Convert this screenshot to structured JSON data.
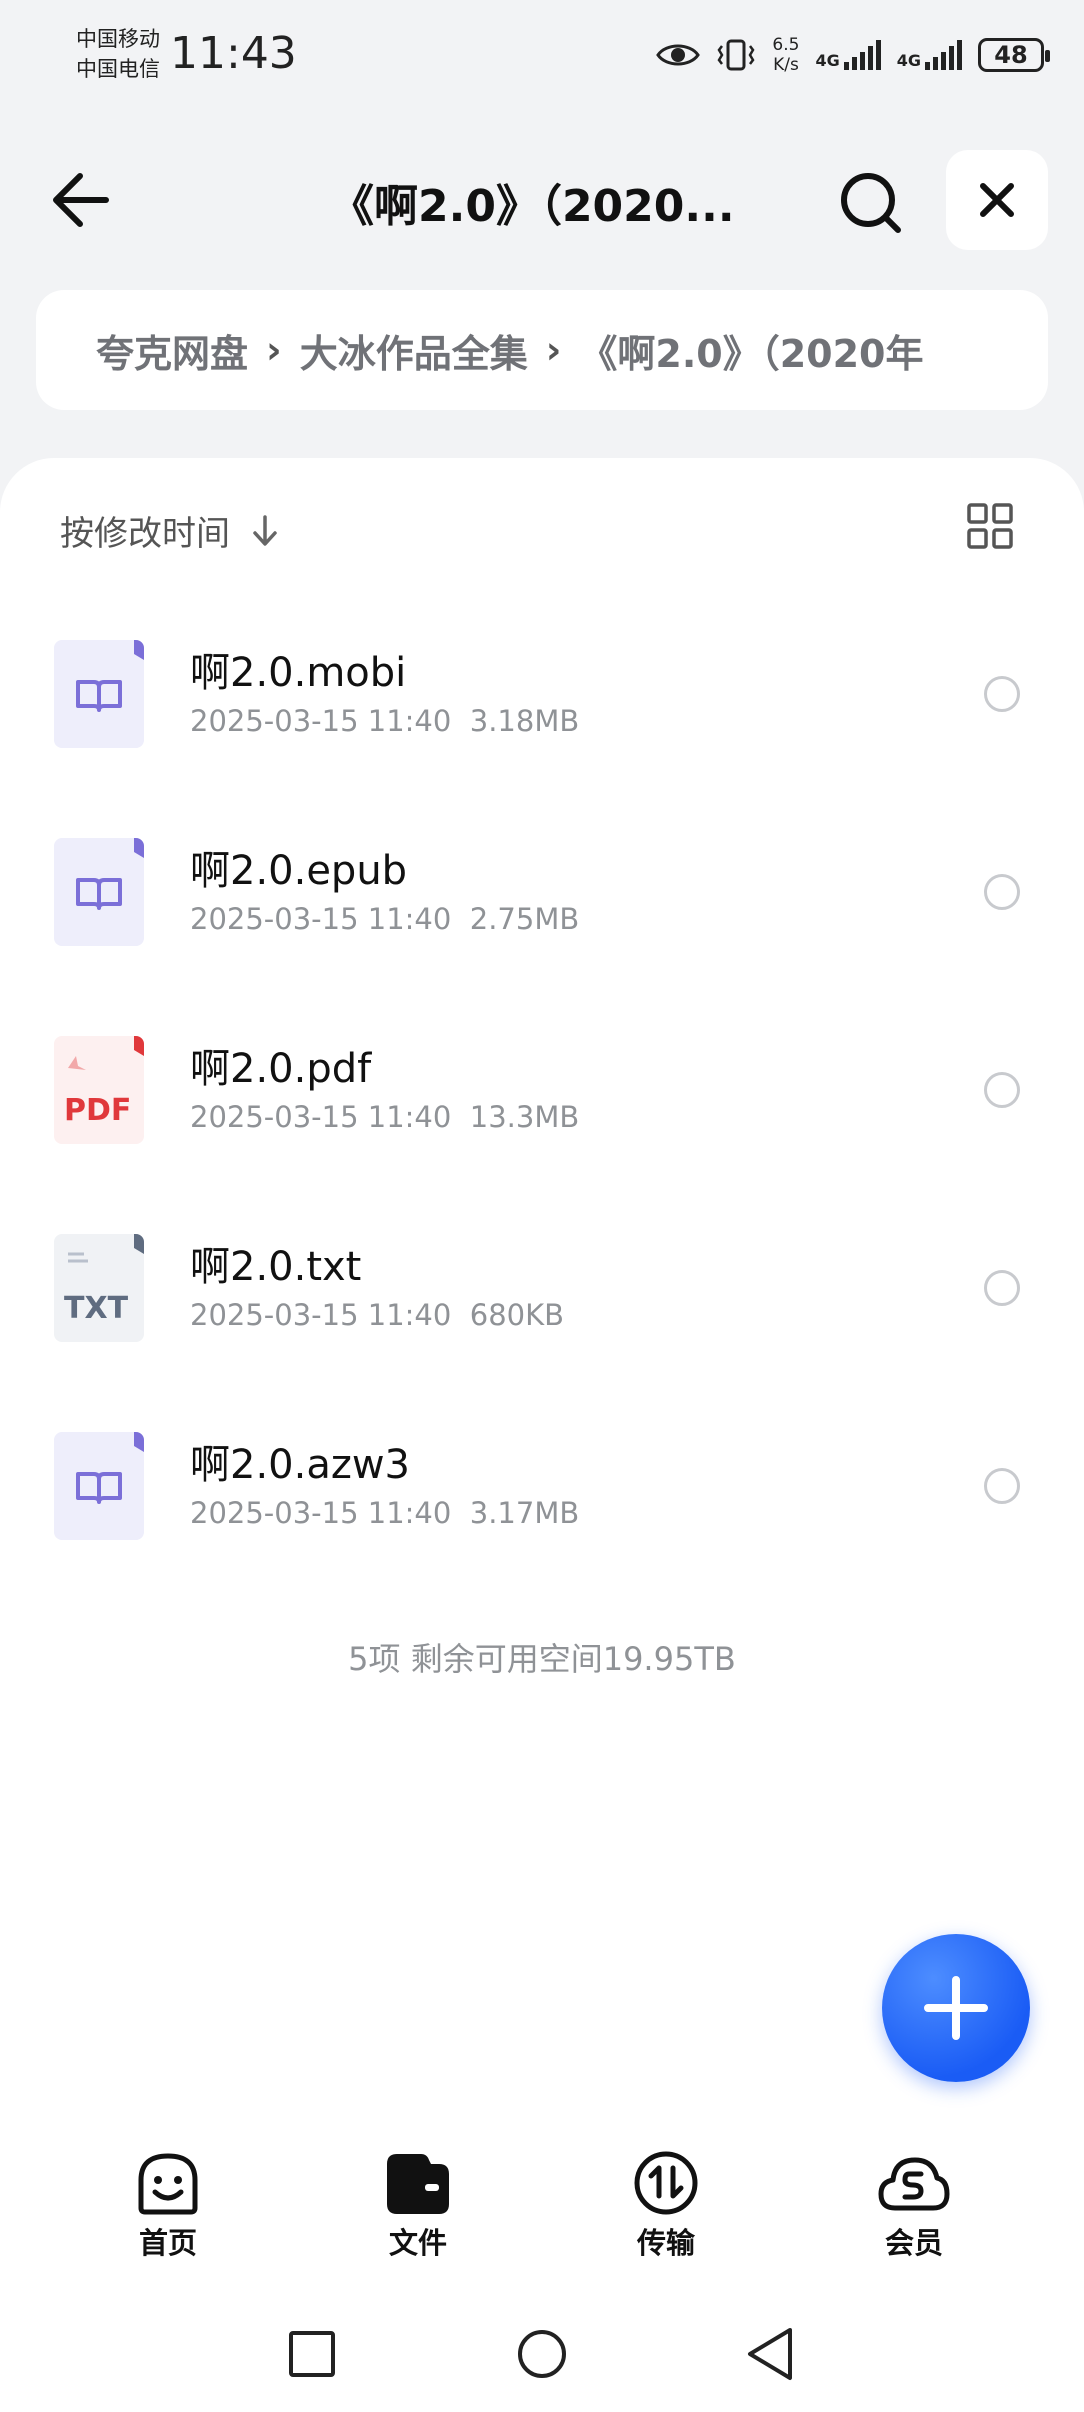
{
  "status_bar": {
    "carrier1": "中国移动",
    "carrier2": "中国电信",
    "time": "11:43",
    "speed_value": "6.5",
    "speed_unit": "K/s",
    "net1": "4G",
    "net2": "4G",
    "battery": "48"
  },
  "header": {
    "title": "《啊2.0》（2020..."
  },
  "breadcrumb": [
    "夸克网盘",
    "大冰作品全集",
    "《啊2.0》（2020年"
  ],
  "sort_label": "按修改时间",
  "files": [
    {
      "name": "啊2.0.mobi",
      "date": "2025-03-15 11:40",
      "size": "3.18MB",
      "type": "book"
    },
    {
      "name": "啊2.0.epub",
      "date": "2025-03-15 11:40",
      "size": "2.75MB",
      "type": "book"
    },
    {
      "name": "啊2.0.pdf",
      "date": "2025-03-15 11:40",
      "size": "13.3MB",
      "type": "pdf",
      "badge": "PDF"
    },
    {
      "name": "啊2.0.txt",
      "date": "2025-03-15 11:40",
      "size": "680KB",
      "type": "txt",
      "badge": "TXT"
    },
    {
      "name": "啊2.0.azw3",
      "date": "2025-03-15 11:40",
      "size": "3.17MB",
      "type": "book"
    }
  ],
  "summary": "5项 剩余可用空间19.95TB",
  "bottom_nav": [
    {
      "label": "首页",
      "icon": "smile-face-icon"
    },
    {
      "label": "文件",
      "icon": "wallet-folder-icon"
    },
    {
      "label": "传输",
      "icon": "transfer-icon"
    },
    {
      "label": "会员",
      "icon": "cloud-s-icon"
    }
  ],
  "colors": {
    "accent": "#1a5cf5",
    "book_icon": "#7b6fd8",
    "pdf": "#e0383b",
    "txt": "#5f6c80"
  }
}
